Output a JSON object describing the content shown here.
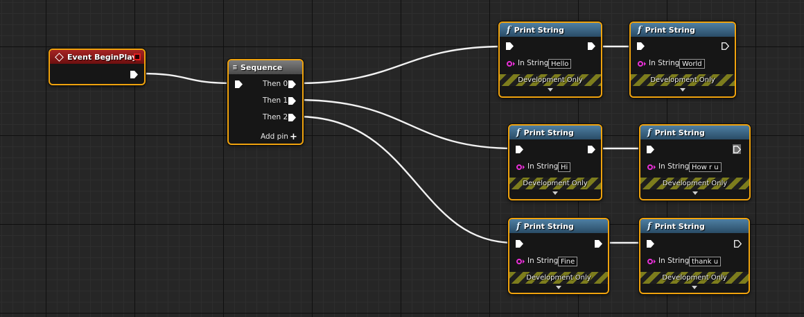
{
  "graph": {
    "event_node": {
      "title": "Event BeginPlay"
    },
    "sequence_node": {
      "title": "Sequence",
      "outputs": [
        {
          "label": "Then 0"
        },
        {
          "label": "Then 1"
        },
        {
          "label": "Then 2"
        }
      ],
      "add_pin_label": "Add pin"
    },
    "print_nodes": [
      {
        "title": "Print String",
        "in_label": "In String",
        "value": "Hello",
        "dev_label": "Development Only"
      },
      {
        "title": "Print String",
        "in_label": "In String",
        "value": "World",
        "dev_label": "Development Only"
      },
      {
        "title": "Print String",
        "in_label": "In String",
        "value": "Hi",
        "dev_label": "Development Only"
      },
      {
        "title": "Print String",
        "in_label": "In String",
        "value": "How r u",
        "dev_label": "Development Only"
      },
      {
        "title": "Print String",
        "in_label": "In String",
        "value": "Fine",
        "dev_label": "Development Only"
      },
      {
        "title": "Print String",
        "in_label": "In String",
        "value": "thank u",
        "dev_label": "Development Only"
      }
    ]
  },
  "colors": {
    "node_border": "#f0a30e",
    "event_header": "#a52323",
    "function_header": "#4e7fa3",
    "sequence_header": "#6a6a6a",
    "exec_wire": "#f2f2f2",
    "string_pin": "#e82fd7"
  },
  "icons": {
    "event": "event-diamond-icon",
    "delegate": "delegate-square-icon",
    "sequence": "sequence-icon",
    "function": "function-f-icon",
    "exec": "exec-pin-icon",
    "string_pin": "string-pin-icon",
    "add": "plus-icon",
    "expand": "expand-arrow-icon"
  }
}
